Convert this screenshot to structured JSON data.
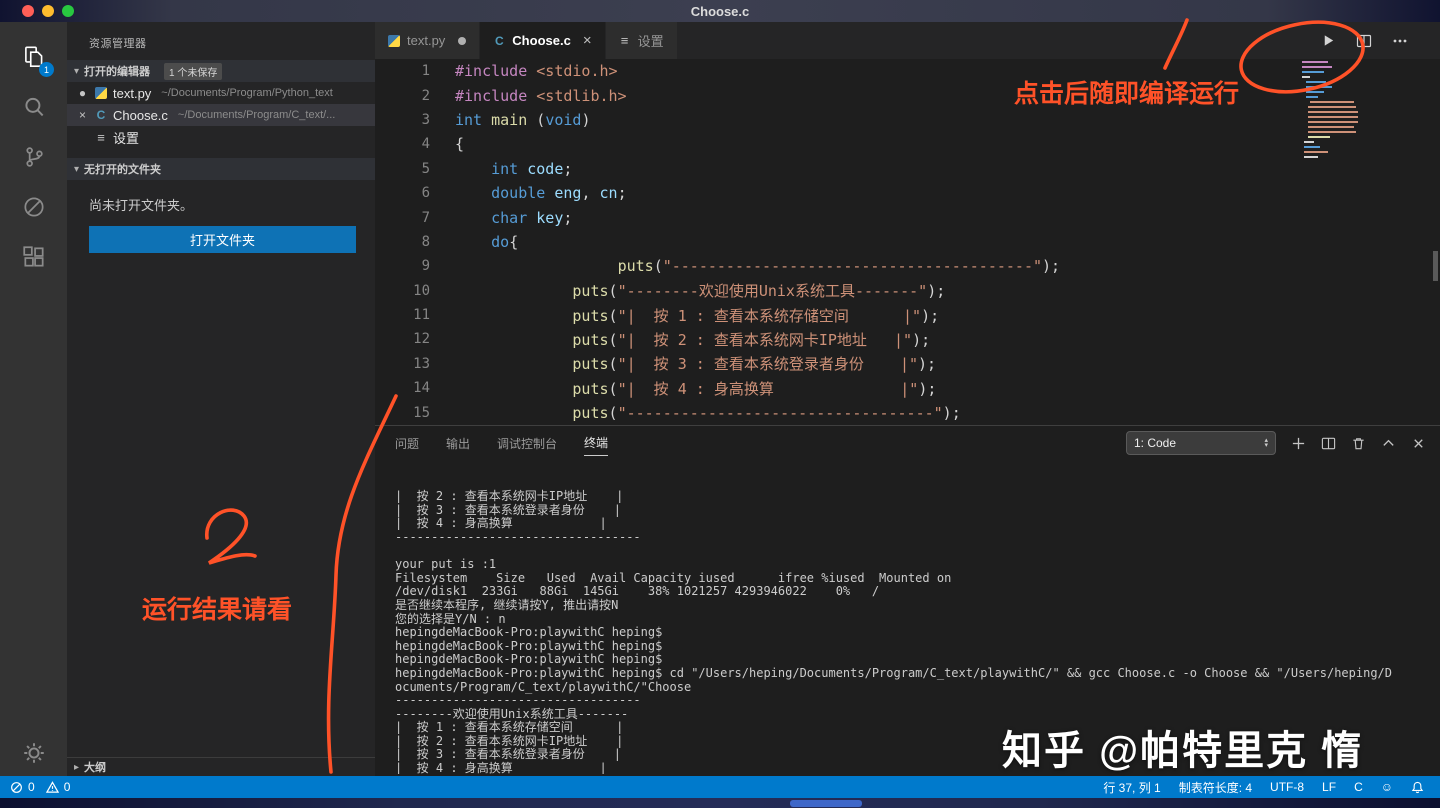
{
  "colors": {
    "accent": "#007acc",
    "annotation": "#ff5228",
    "button": "#0e72b5",
    "statusbar": "#007acc"
  },
  "title_bar": {
    "title": "Choose.c"
  },
  "activity_bar": {
    "explorer_badge": "1"
  },
  "sidebar": {
    "title": "资源管理器",
    "open_editors": {
      "label": "打开的编辑器",
      "badge": "1 个未保存",
      "items": [
        {
          "name": "text.py",
          "path": "~/Documents/Program/Python_text"
        },
        {
          "name": "Choose.c",
          "path": "~/Documents/Program/C_text/..."
        },
        {
          "name": "设置",
          "path": ""
        }
      ]
    },
    "folder_section": {
      "label": "无打开的文件夹",
      "message": "尚未打开文件夹。",
      "button": "打开文件夹"
    },
    "outline_label": "大纲"
  },
  "tabs": [
    {
      "label": "text.py"
    },
    {
      "label": "Choose.c"
    },
    {
      "label": "设置"
    }
  ],
  "editor": {
    "lines": [
      [
        [
          "pp",
          "#include"
        ],
        [
          "pln",
          " "
        ],
        [
          "str",
          "<stdio.h>"
        ]
      ],
      [
        [
          "pp",
          "#include"
        ],
        [
          "pln",
          " "
        ],
        [
          "str",
          "<stdlib.h>"
        ]
      ],
      [
        [
          "kw",
          "int"
        ],
        [
          "pln",
          " "
        ],
        [
          "fn",
          "main"
        ],
        [
          "pln",
          " ("
        ],
        [
          "kw",
          "void"
        ],
        [
          "pln",
          ")"
        ]
      ],
      [
        [
          "pln",
          "{"
        ]
      ],
      [
        [
          "pln",
          "    "
        ],
        [
          "kw",
          "int"
        ],
        [
          "pln",
          " "
        ],
        [
          "var",
          "code"
        ],
        [
          "pln",
          ";"
        ]
      ],
      [
        [
          "pln",
          "    "
        ],
        [
          "kw",
          "double"
        ],
        [
          "pln",
          " "
        ],
        [
          "var",
          "eng"
        ],
        [
          "pln",
          ", "
        ],
        [
          "var",
          "cn"
        ],
        [
          "pln",
          ";"
        ]
      ],
      [
        [
          "pln",
          "    "
        ],
        [
          "kw",
          "char"
        ],
        [
          "pln",
          " "
        ],
        [
          "var",
          "key"
        ],
        [
          "pln",
          ";"
        ]
      ],
      [
        [
          "pln",
          "    "
        ],
        [
          "kw",
          "do"
        ],
        [
          "pln",
          "{"
        ]
      ],
      [
        [
          "pln",
          "                  "
        ],
        [
          "fn",
          "puts"
        ],
        [
          "pln",
          "("
        ],
        [
          "str",
          "\"----------------------------------------\""
        ],
        [
          "pln",
          ");"
        ]
      ],
      [
        [
          "pln",
          "             "
        ],
        [
          "fn",
          "puts"
        ],
        [
          "pln",
          "("
        ],
        [
          "str",
          "\"--------欢迎使用Unix系统工具-------\""
        ],
        [
          "pln",
          ");"
        ]
      ],
      [
        [
          "pln",
          "             "
        ],
        [
          "fn",
          "puts"
        ],
        [
          "pln",
          "("
        ],
        [
          "str",
          "\"|  按 1 : 查看本系统存储空间      |\""
        ],
        [
          "pln",
          ");"
        ]
      ],
      [
        [
          "pln",
          "             "
        ],
        [
          "fn",
          "puts"
        ],
        [
          "pln",
          "("
        ],
        [
          "str",
          "\"|  按 2 : 查看本系统网卡IP地址   |\""
        ],
        [
          "pln",
          ");"
        ]
      ],
      [
        [
          "pln",
          "             "
        ],
        [
          "fn",
          "puts"
        ],
        [
          "pln",
          "("
        ],
        [
          "str",
          "\"|  按 3 : 查看本系统登录者身份    |\""
        ],
        [
          "pln",
          ");"
        ]
      ],
      [
        [
          "pln",
          "             "
        ],
        [
          "fn",
          "puts"
        ],
        [
          "pln",
          "("
        ],
        [
          "str",
          "\"|  按 4 : 身高换算              |\""
        ],
        [
          "pln",
          ");"
        ]
      ],
      [
        [
          "pln",
          "             "
        ],
        [
          "fn",
          "puts"
        ],
        [
          "pln",
          "("
        ],
        [
          "str",
          "\"----------------------------------\""
        ],
        [
          "pln",
          ");"
        ]
      ]
    ]
  },
  "panel": {
    "tabs": [
      "问题",
      "输出",
      "调试控制台",
      "终端"
    ],
    "active_tab": "终端",
    "dropdown": "1: Code"
  },
  "terminal": {
    "lines": [
      "|  按 2 : 查看本系统网卡IP地址    |",
      "|  按 3 : 查看本系统登录者身份    |",
      "|  按 4 : 身高换算            |",
      "----------------------------------",
      "",
      "your put is :1",
      "Filesystem    Size   Used  Avail Capacity iused      ifree %iused  Mounted on",
      "/dev/disk1  233Gi   88Gi  145Gi    38% 1021257 4293946022    0%   /",
      "是否继续本程序, 继续请按Y, 推出请按N",
      "您的选择是Y/N : n",
      "hepingdeMacBook-Pro:playwithC heping$",
      "hepingdeMacBook-Pro:playwithC heping$",
      "hepingdeMacBook-Pro:playwithC heping$",
      "hepingdeMacBook-Pro:playwithC heping$ cd \"/Users/heping/Documents/Program/C_text/playwithC/\" && gcc Choose.c -o Choose && \"/Users/heping/D",
      "ocuments/Program/C_text/playwithC/\"Choose",
      "----------------------------------",
      "--------欢迎使用Unix系统工具-------",
      "|  按 1 : 查看本系统存储空间      |",
      "|  按 2 : 查看本系统网卡IP地址    |",
      "|  按 3 : 查看本系统登录者身份    |",
      "|  按 4 : 身高换算            |",
      "----------------------------------"
    ],
    "prompt": "your put is :"
  },
  "status_bar": {
    "errors": "0",
    "warnings": "0",
    "cursor": "行 37, 列 1",
    "tabsize": "制表符长度: 4",
    "encoding": "UTF-8",
    "eol": "LF",
    "language": "C"
  },
  "annotations": {
    "compile_note": "点击后随即编译运行",
    "result_note": "运行结果请看",
    "digit": "2"
  },
  "watermark": "知乎 @帕特里克 惰"
}
